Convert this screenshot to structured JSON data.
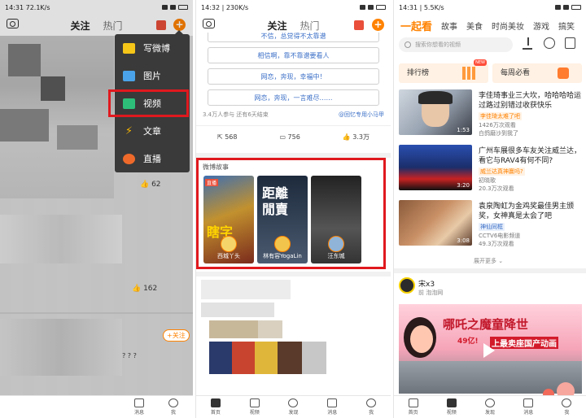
{
  "screen1": {
    "status": {
      "time": "14:31",
      "speed": "72.1K/s"
    },
    "nav": {
      "active_tab": "关注",
      "inactive_tab": "热门"
    },
    "menu": [
      {
        "label": "写微博",
        "icon": "compose-icon",
        "color": "#f5c518"
      },
      {
        "label": "图片",
        "icon": "image-icon",
        "color": "#4aa3e8"
      },
      {
        "label": "视频",
        "icon": "video-icon",
        "color": "#2dbf7a"
      },
      {
        "label": "文章",
        "icon": "lightning-icon",
        "color": "#f5b400"
      },
      {
        "label": "直播",
        "icon": "live-icon",
        "color": "#ef6a2a"
      }
    ],
    "likes_1": "62",
    "likes_2": "162",
    "follow_label": "+关注",
    "emoji_text": "? ? ?",
    "tabbar": {
      "messages": "消息",
      "me": "我"
    }
  },
  "screen2": {
    "status": {
      "time": "14:32",
      "speed": "230K/s"
    },
    "nav": {
      "active_tab": "关注",
      "inactive_tab": "热门"
    },
    "poll_options": [
      "不信，总觉得不太靠谱",
      "相信啊，靠不靠谱要看人",
      "网恋，奔现，幸福中！",
      "网恋，奔现，一言难尽……"
    ],
    "poll_meta": "3.4万人参与  还有6天结束",
    "poll_source": "@回忆专用小马甲",
    "actions": {
      "reposts": "568",
      "comments": "756",
      "likes": "3.3万"
    },
    "story_title": "微博故事",
    "stories": [
      {
        "name": "西城丫头",
        "badge": "直播",
        "text": "瞎字"
      },
      {
        "name": "林有容YogaLin",
        "text": "距離 閒賣"
      },
      {
        "name": "汪东城",
        "text": ""
      }
    ],
    "tabbar": [
      {
        "label": "首页",
        "icon": "home-icon"
      },
      {
        "label": "视频",
        "icon": "video-icon"
      },
      {
        "label": "发现",
        "icon": "discover-icon"
      },
      {
        "label": "消息",
        "icon": "message-icon"
      },
      {
        "label": "我",
        "icon": "profile-icon"
      }
    ]
  },
  "screen3": {
    "status": {
      "time": "14:31",
      "speed": "5.5K/s"
    },
    "nav_tabs": [
      "一起看",
      "故事",
      "美食",
      "时尚美妆",
      "游戏",
      "搞笑"
    ],
    "search_placeholder": "搜索你想看的视频",
    "rank_label": "排行榜",
    "rank_badge": "NEW",
    "weekly_label": "每周必看",
    "videos": [
      {
        "title": "李佳琦事业三大坎，哈哈哈哈运过路过别错过收获快乐",
        "tag": "李佳琦太难了吧",
        "views": "1426万次观看",
        "author": "白鸽磨沙到我了",
        "duration": "1:53"
      },
      {
        "title": "广州车展很多车友关注威兰达，看它与RAV4有何不同?",
        "tag": "威兰达真神赢吗?",
        "views": "20.3万次观看",
        "author": "初晓歌",
        "duration": "3:20"
      },
      {
        "title": "袁泉陶虹为金鸡奖最佳男主颁奖，女神真是太会了吧",
        "tag": "神仙同框",
        "views": "49.3万次观看",
        "author": "CCTV6电影频道",
        "duration": "3:08"
      }
    ],
    "expand_label": "展开更多",
    "post": {
      "author": "宋x3",
      "source": "前 泡泡网"
    },
    "poster_text": "哪吒之魔童降世",
    "poster_sub": "49亿!",
    "poster_sub2": "上最卖座国产动画",
    "tabbar": [
      {
        "label": "首页",
        "icon": "home-icon"
      },
      {
        "label": "视频",
        "icon": "video-icon"
      },
      {
        "label": "发现",
        "icon": "discover-icon"
      },
      {
        "label": "消息",
        "icon": "message-icon"
      },
      {
        "label": "我",
        "icon": "profile-icon"
      }
    ]
  },
  "colors": {
    "accent": "#ff8200",
    "highlight": "#e0191e",
    "link": "#3b6fc7"
  }
}
